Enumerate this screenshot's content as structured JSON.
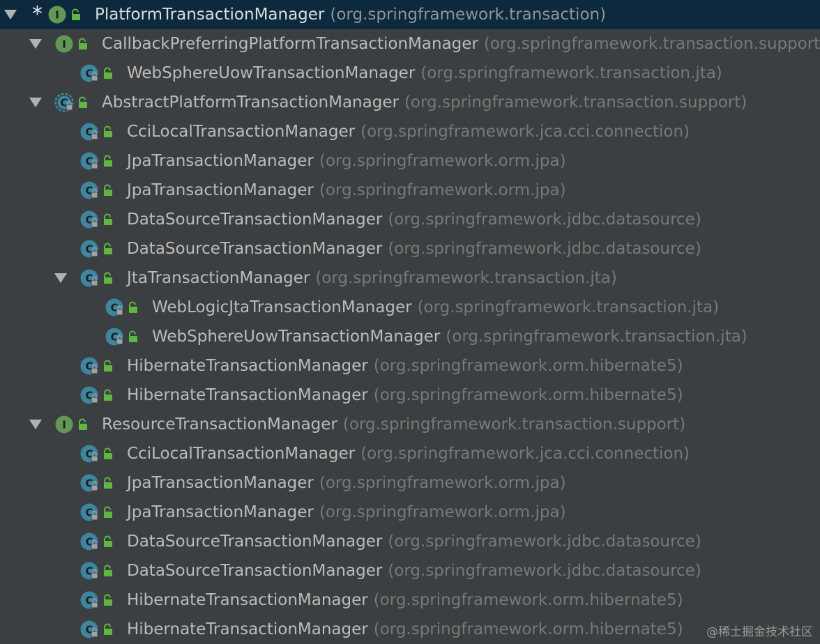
{
  "tree": {
    "rows": [
      {
        "depth": 0,
        "kind": "interface",
        "arrow": true,
        "marker": "*",
        "name": "PlatformTransactionManager",
        "package": "(org.springframework.transaction)",
        "selected": true,
        "icon": "interface-icon"
      },
      {
        "depth": 1,
        "kind": "interface",
        "arrow": true,
        "name": "CallbackPreferringPlatformTransactionManager",
        "package": "(org.springframework.transaction.support)",
        "icon": "interface-icon"
      },
      {
        "depth": 2,
        "kind": "class",
        "arrow": false,
        "name": "WebSphereUowTransactionManager",
        "package": "(org.springframework.transaction.jta)",
        "icon": "class-icon"
      },
      {
        "depth": 1,
        "kind": "abstract",
        "arrow": true,
        "name": "AbstractPlatformTransactionManager",
        "package": "(org.springframework.transaction.support)",
        "icon": "abstract-class-icon"
      },
      {
        "depth": 2,
        "kind": "class",
        "arrow": false,
        "name": "CciLocalTransactionManager",
        "package": "(org.springframework.jca.cci.connection)",
        "icon": "class-icon"
      },
      {
        "depth": 2,
        "kind": "class",
        "arrow": false,
        "name": "JpaTransactionManager",
        "package": "(org.springframework.orm.jpa)",
        "icon": "class-icon"
      },
      {
        "depth": 2,
        "kind": "class",
        "arrow": false,
        "name": "JpaTransactionManager",
        "package": "(org.springframework.orm.jpa)",
        "icon": "class-icon"
      },
      {
        "depth": 2,
        "kind": "class",
        "arrow": false,
        "name": "DataSourceTransactionManager",
        "package": "(org.springframework.jdbc.datasource)",
        "icon": "class-icon"
      },
      {
        "depth": 2,
        "kind": "class",
        "arrow": false,
        "name": "DataSourceTransactionManager",
        "package": "(org.springframework.jdbc.datasource)",
        "icon": "class-icon"
      },
      {
        "depth": 2,
        "kind": "class",
        "arrow": true,
        "name": "JtaTransactionManager",
        "package": "(org.springframework.transaction.jta)",
        "icon": "class-icon"
      },
      {
        "depth": 3,
        "kind": "class",
        "arrow": false,
        "name": "WebLogicJtaTransactionManager",
        "package": "(org.springframework.transaction.jta)",
        "icon": "class-icon"
      },
      {
        "depth": 3,
        "kind": "class",
        "arrow": false,
        "name": "WebSphereUowTransactionManager",
        "package": "(org.springframework.transaction.jta)",
        "icon": "class-icon"
      },
      {
        "depth": 2,
        "kind": "class",
        "arrow": false,
        "name": "HibernateTransactionManager",
        "package": "(org.springframework.orm.hibernate5)",
        "icon": "class-icon"
      },
      {
        "depth": 2,
        "kind": "class",
        "arrow": false,
        "name": "HibernateTransactionManager",
        "package": "(org.springframework.orm.hibernate5)",
        "icon": "class-icon"
      },
      {
        "depth": 1,
        "kind": "interface",
        "arrow": true,
        "name": "ResourceTransactionManager",
        "package": "(org.springframework.transaction.support)",
        "icon": "interface-icon"
      },
      {
        "depth": 2,
        "kind": "class",
        "arrow": false,
        "name": "CciLocalTransactionManager",
        "package": "(org.springframework.jca.cci.connection)",
        "icon": "class-icon"
      },
      {
        "depth": 2,
        "kind": "class",
        "arrow": false,
        "name": "JpaTransactionManager",
        "package": "(org.springframework.orm.jpa)",
        "icon": "class-icon"
      },
      {
        "depth": 2,
        "kind": "class",
        "arrow": false,
        "name": "JpaTransactionManager",
        "package": "(org.springframework.orm.jpa)",
        "icon": "class-icon"
      },
      {
        "depth": 2,
        "kind": "class",
        "arrow": false,
        "name": "DataSourceTransactionManager",
        "package": "(org.springframework.jdbc.datasource)",
        "icon": "class-icon"
      },
      {
        "depth": 2,
        "kind": "class",
        "arrow": false,
        "name": "DataSourceTransactionManager",
        "package": "(org.springframework.jdbc.datasource)",
        "icon": "class-icon"
      },
      {
        "depth": 2,
        "kind": "class",
        "arrow": false,
        "name": "HibernateTransactionManager",
        "package": "(org.springframework.orm.hibernate5)",
        "icon": "class-icon"
      },
      {
        "depth": 2,
        "kind": "class",
        "arrow": false,
        "name": "HibernateTransactionManager",
        "package": "(org.springframework.orm.hibernate5)",
        "icon": "class-icon"
      }
    ]
  },
  "watermark": "@稀土掘金技术社区",
  "colors": {
    "background": "#3c3f41",
    "selection": "#0d293e",
    "class_icon": "#3e86a0",
    "interface_icon": "#629755",
    "lock": "#62b543",
    "name_text": "#bbbbbb",
    "package_text": "#787878"
  }
}
